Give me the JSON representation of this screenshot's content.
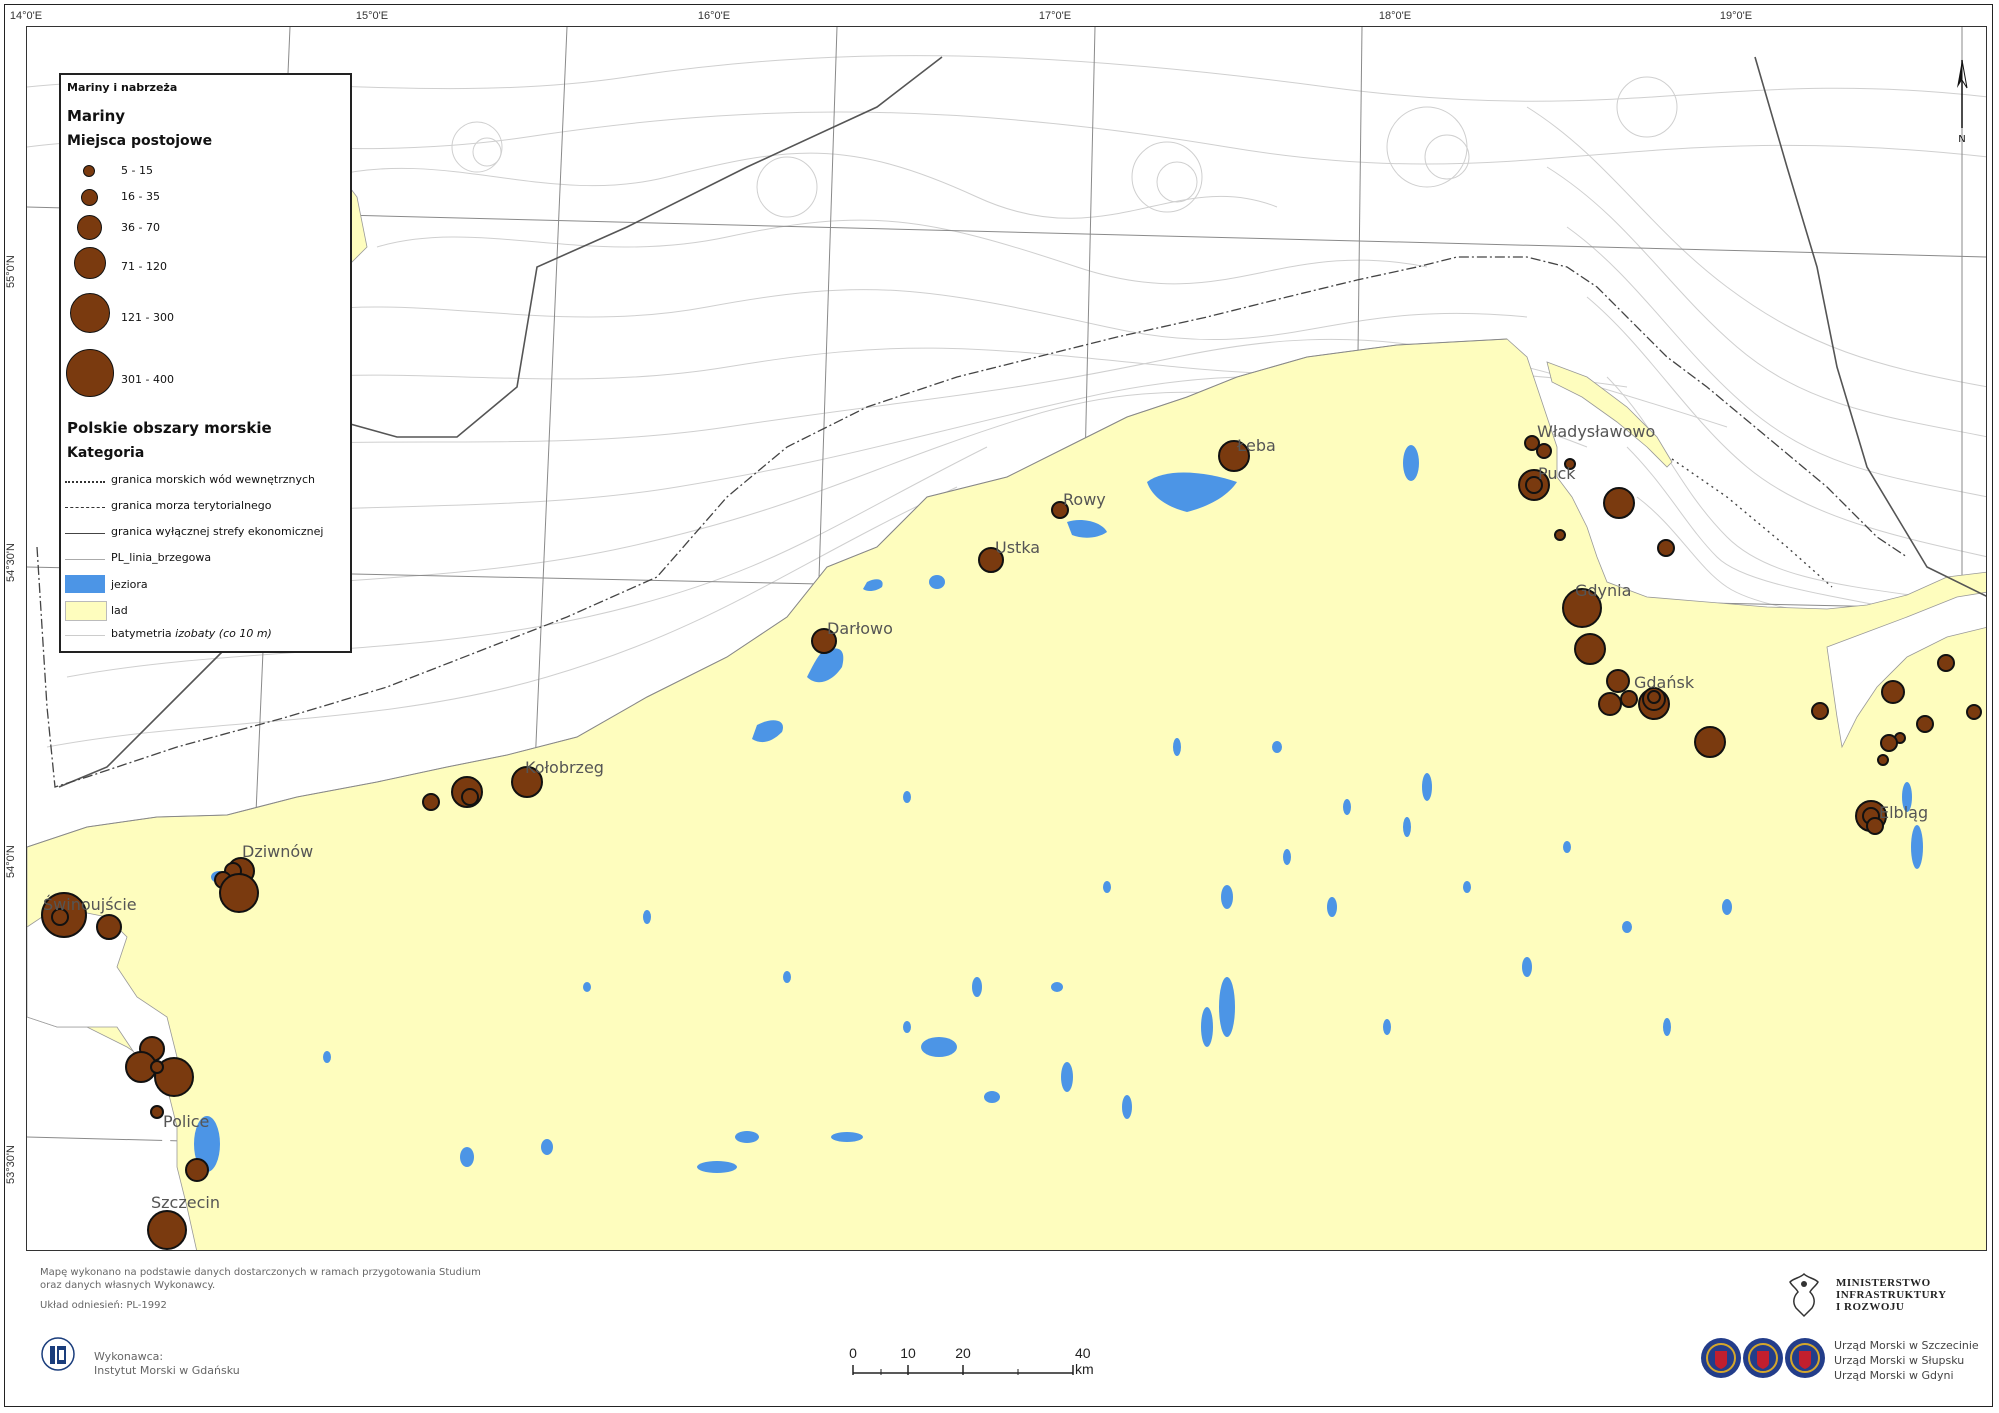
{
  "map": {
    "colors": {
      "land": "#fefdbe",
      "sea": "#ffffff",
      "lake": "#4c95e6",
      "marina_fill": "#7a3a0f",
      "marina_stroke": "#111111",
      "contour": "#c8c8c8",
      "grid": "#888888",
      "eez": "#555555"
    },
    "longitude_labels": [
      "14°0'E",
      "15°0'E",
      "16°0'E",
      "17°0'E",
      "18°0'E",
      "19°0'E"
    ],
    "latitude_labels": [
      "55°0'N",
      "54°30'N",
      "54°0'N",
      "53°30'N"
    ],
    "places": [
      "Władysławowo",
      "Puck",
      "Łeba",
      "Rowy",
      "Ustka",
      "Gdynia",
      "Darłowo",
      "Gdańsk",
      "Kołobrzeg",
      "Elbląg",
      "Dziwnów",
      "Świnoujście",
      "Police",
      "Szczecin"
    ],
    "north_arrow_label": "N"
  },
  "legend": {
    "title": "Mariny i nabrzeża",
    "group1": "Mariny",
    "subgroup1": "Miejsca postojowe",
    "size_classes": [
      {
        "label": "5 - 15",
        "icon": "marina-xs"
      },
      {
        "label": "16 - 35",
        "icon": "marina-s"
      },
      {
        "label": "36 - 70",
        "icon": "marina-m"
      },
      {
        "label": "71 - 120",
        "icon": "marina-l"
      },
      {
        "label": "121 - 300",
        "icon": "marina-xl"
      },
      {
        "label": "301 - 400",
        "icon": "marina-xxl"
      }
    ],
    "group2": "Polskie obszary morskie",
    "subgroup2": "Kategoria",
    "categories": [
      {
        "label": "granica morskich wód wewnętrznych",
        "style": "dotted"
      },
      {
        "label": "granica morza terytorialnego",
        "style": "dash-dot"
      },
      {
        "label": "granica wyłącznej strefy ekonomicznej",
        "style": "solid"
      },
      {
        "label": "PL_linia_brzegowa",
        "style": "thin"
      },
      {
        "label": "jeziora",
        "style": "lake"
      },
      {
        "label": "lad",
        "style": "land"
      }
    ],
    "bathymetry_label": "batymetria",
    "bathymetry_note": "izobaty (co 10 m)"
  },
  "footer": {
    "source_line1": "Mapę wykonano na podstawie danych dostarczonych w ramach przygotowania Studium",
    "source_line2": "oraz danych własnych Wykonawcy.",
    "reference_system": "Układ odniesień: PL-1992",
    "executor_label": "Wykonawca:",
    "executor_name": "Instytut Morski w Gdańsku",
    "scale_ticks": [
      "0",
      "10",
      "20",
      "40 km"
    ],
    "ministry_line1": "MINISTERSTWO",
    "ministry_line2": "INFRASTRUKTURY",
    "ministry_line3": "I ROZWOJU",
    "um1": "Urząd Morski w Szczecinie",
    "um2": "Urząd Morski w Słupsku",
    "um3": "Urząd Morski w Gdyni"
  }
}
